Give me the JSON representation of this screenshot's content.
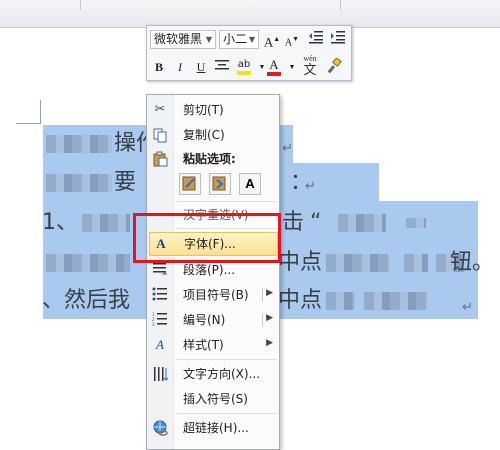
{
  "doc": {
    "line1_text": "操作",
    "line2_text": "要",
    "line2_colon": "：",
    "line3_dot": "1、",
    "line3_mid": "击",
    "line3_quote": "“",
    "line4_mid": "中点",
    "line4_end": "钮。",
    "line5_text": "、然后我",
    "line5_mid": "中点",
    "para_mark": "↵"
  },
  "mini_toolbar": {
    "font_name": "微软雅黑",
    "font_size": "小二",
    "grow_label": "A",
    "shrink_label": "A",
    "bold_label": "B",
    "italic_label": "I",
    "underline_label": "U",
    "highlight_label": "ab",
    "fontcolor_label": "A",
    "phonetic_label": "wén",
    "phonetic_char": "文"
  },
  "context_menu": {
    "items": [
      {
        "label": "剪切(T)",
        "icon": "scissors-icon"
      },
      {
        "label": "复制(C)",
        "icon": "copy-icon"
      },
      {
        "label": "粘贴选项:",
        "icon": "clipboard-icon"
      },
      {
        "label": "汉字重选(V)",
        "icon": ""
      },
      {
        "label": "字体(F)...",
        "icon": "font-icon"
      },
      {
        "label": "段落(P)...",
        "icon": "paragraph-icon"
      },
      {
        "label": "项目符号(B)",
        "icon": "bullets-icon"
      },
      {
        "label": "编号(N)",
        "icon": "numbering-icon"
      },
      {
        "label": "样式(T)",
        "icon": "styles-icon"
      },
      {
        "label": "文字方向(X)...",
        "icon": "text-direction-icon"
      },
      {
        "label": "插入符号(S)",
        "icon": ""
      },
      {
        "label": "超链接(H)...",
        "icon": "hyperlink-icon"
      }
    ],
    "paste_options": [
      "keep-formatting",
      "merge-formatting",
      "text-only"
    ],
    "paste_text_only_label": "A",
    "highlighted_item": "字体(F)...",
    "highlight_color": "#fbe08f",
    "annotation_color": "#e8141d"
  },
  "colors": {
    "selection": "#a9c9ef",
    "fontcolor_bar": "#d42020",
    "highlight_bar": "#f3e21a"
  }
}
